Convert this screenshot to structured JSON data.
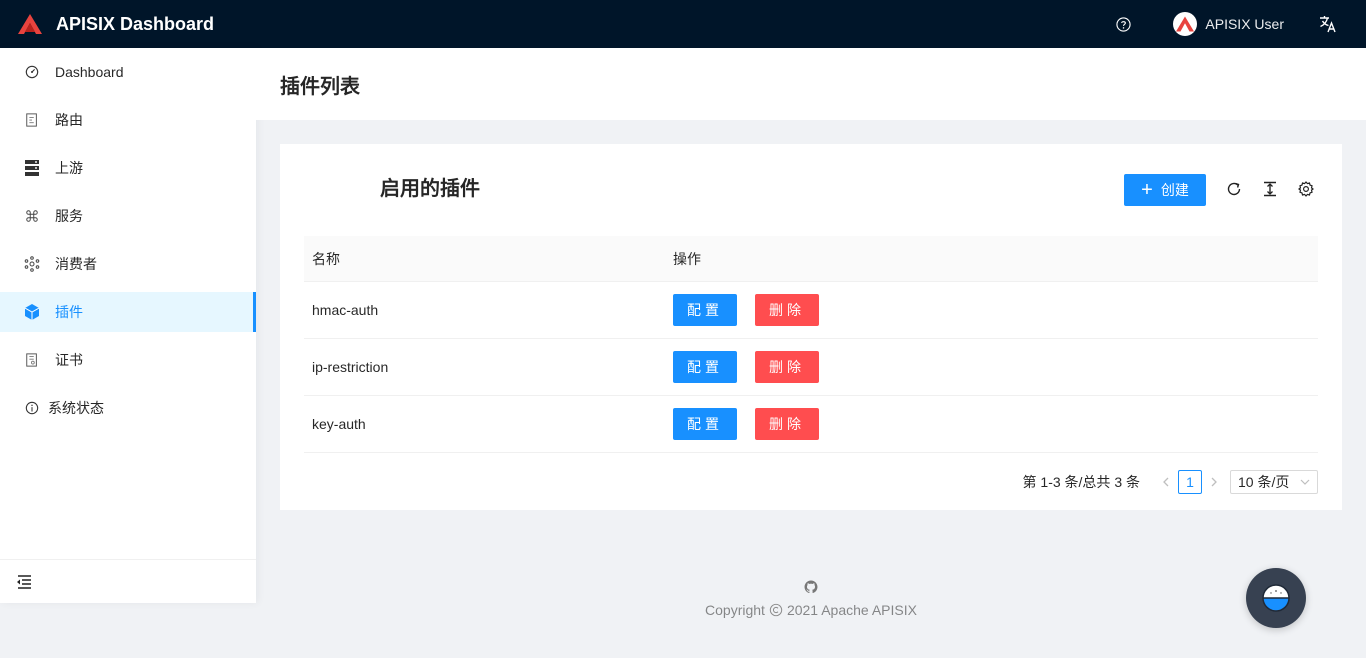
{
  "header": {
    "app_title": "APISIX Dashboard",
    "user_name": "APISIX User",
    "icons": [
      "apisix-logo-icon",
      "help-icon",
      "avatar-icon",
      "translate-icon"
    ]
  },
  "sidebar": {
    "items": [
      {
        "label": "Dashboard",
        "icon": "dashboard-icon",
        "active": false
      },
      {
        "label": "路由",
        "icon": "route-icon",
        "active": false
      },
      {
        "label": "上游",
        "icon": "upstream-icon",
        "active": false
      },
      {
        "label": "服务",
        "icon": "service-icon",
        "active": false
      },
      {
        "label": "消费者",
        "icon": "consumer-icon",
        "active": false
      },
      {
        "label": "插件",
        "icon": "plugin-icon",
        "active": true
      },
      {
        "label": "证书",
        "icon": "certificate-icon",
        "active": false
      },
      {
        "label": "系统状态",
        "icon": "info-icon",
        "active": false
      }
    ]
  },
  "page": {
    "title": "插件列表"
  },
  "card": {
    "title": "启用的插件",
    "create_label": "创建",
    "toolbar_icons": [
      "reload-icon",
      "column-height-icon",
      "setting-icon"
    ]
  },
  "table": {
    "columns": [
      "名称",
      "操作"
    ],
    "rows": [
      {
        "name": "hmac-auth",
        "config": "配置",
        "delete": "删除"
      },
      {
        "name": "ip-restriction",
        "config": "配置",
        "delete": "删除"
      },
      {
        "name": "key-auth",
        "config": "配置",
        "delete": "删除"
      }
    ]
  },
  "pagination": {
    "total_text": "第 1-3 条/总共 3 条",
    "current_page": "1",
    "page_size": "10 条/页"
  },
  "footer": {
    "copyright": "Copyright",
    "copyright_rest": "2021 Apache APISIX"
  },
  "colors": {
    "primary": "#1890ff",
    "danger": "#ff4d4f",
    "header_bg": "#001529",
    "logo_red": "#e8433e"
  }
}
